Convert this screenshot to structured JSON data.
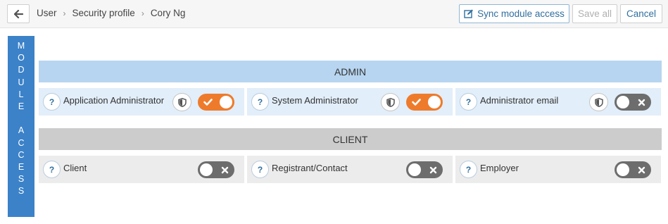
{
  "breadcrumb": [
    "User",
    "Security profile",
    "Cory Ng"
  ],
  "toolbar": {
    "sync_label": "Sync module access",
    "save_label": "Save all",
    "cancel_label": "Cancel"
  },
  "sidebar_label_letters": [
    "M",
    "O",
    "D",
    "U",
    "L",
    "E",
    " ",
    "A",
    "C",
    "C",
    "E",
    "S",
    "S"
  ],
  "sections": {
    "admin": {
      "title": "ADMIN",
      "items": [
        {
          "label": "Application Administrator",
          "enabled": true,
          "has_shield": true
        },
        {
          "label": "System Administrator",
          "enabled": true,
          "has_shield": true
        },
        {
          "label": "Administrator email",
          "enabled": false,
          "has_shield": true
        }
      ]
    },
    "client": {
      "title": "CLIENT",
      "items": [
        {
          "label": "Client",
          "enabled": false,
          "has_shield": false
        },
        {
          "label": "Registrant/Contact",
          "enabled": false,
          "has_shield": false
        },
        {
          "label": "Employer",
          "enabled": false,
          "has_shield": false
        }
      ]
    }
  },
  "colors": {
    "toggle_on": "#ee7b2b",
    "toggle_off": "#6d6d6d",
    "admin_header": "#b7d5f0",
    "client_header": "#cccccc",
    "side_bar": "#3b82c9"
  },
  "icons": {
    "back": "arrow-left-icon",
    "sync": "edit-icon",
    "help": "question-icon",
    "shield": "shield-icon"
  }
}
